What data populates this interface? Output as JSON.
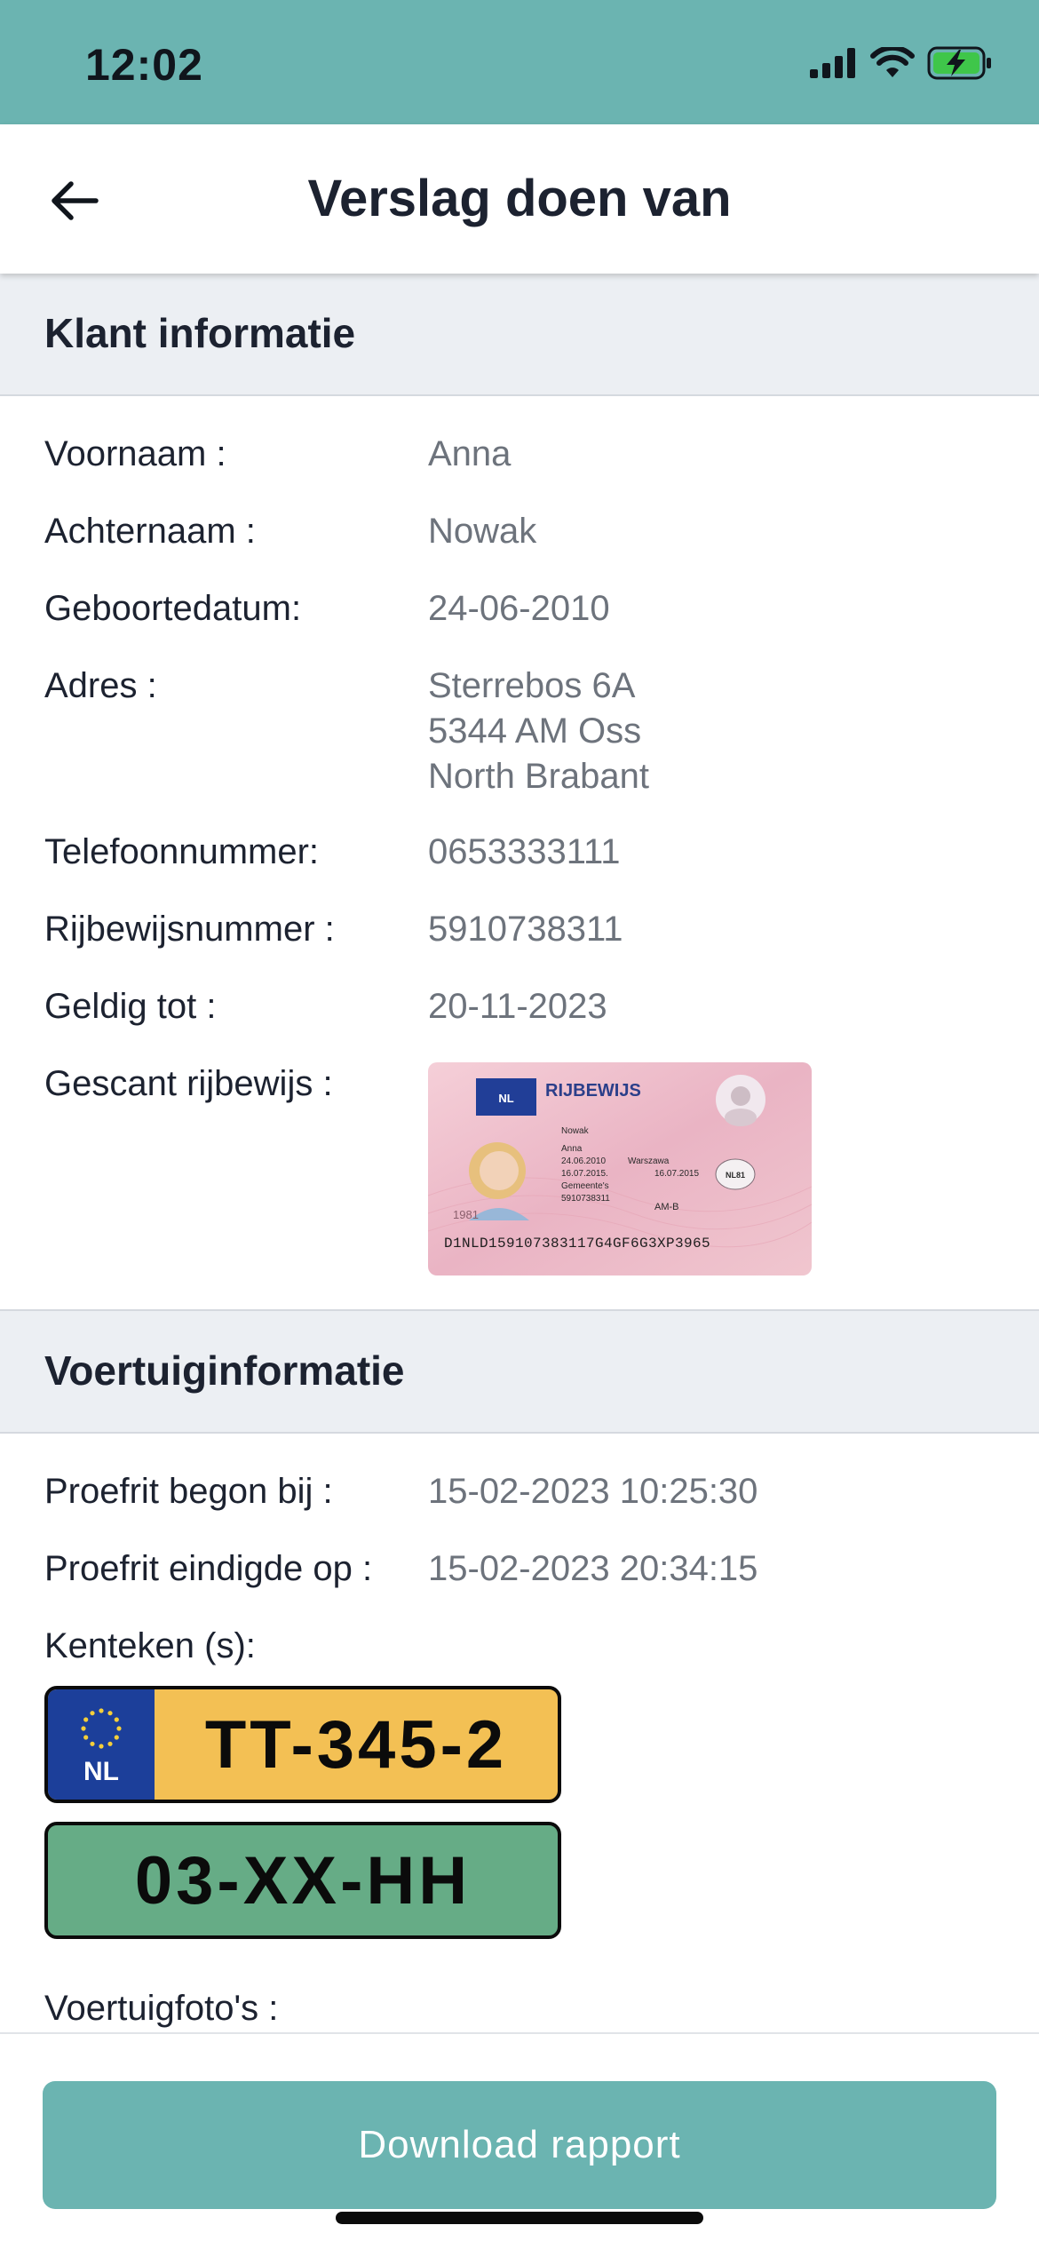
{
  "status_bar": {
    "time": "12:02"
  },
  "nav": {
    "title": "Verslag doen van"
  },
  "customer": {
    "section_title": "Klant informatie",
    "first_name_label": "Voornaam :",
    "first_name": "Anna",
    "last_name_label": "Achternaam :",
    "last_name": "Nowak",
    "dob_label": "Geboortedatum:",
    "dob": "24-06-2010",
    "address_label": "Adres :",
    "address": "Sterrebos 6A\n5344 AM Oss\nNorth Brabant",
    "phone_label": "Telefoonnummer:",
    "phone": "0653333111",
    "license_number_label": "Rijbewijsnummer :",
    "license_number": "5910738311",
    "valid_until_label": "Geldig tot :",
    "valid_until": "20-11-2023",
    "scanned_license_label": "Gescant rijbewijs :"
  },
  "license_card": {
    "country": "NL",
    "title": "RIJBEWIJS",
    "surname": "Nowak",
    "given_name": "Anna",
    "birth_date": "24.06.2010",
    "birth_place": "Warszawa",
    "issue_date": "16.07.2015.",
    "expiry_date": "16.07.2015",
    "authority": "Gemeente's",
    "number": "5910738311",
    "category": "AM-B",
    "badge": "NL81",
    "year": "1981",
    "mrz": "D1NLD159107383117G4GF6G3XP3965"
  },
  "vehicle": {
    "section_title": "Voertuiginformatie",
    "start_label": "Proefrit begon bij :",
    "start": "15-02-2023 10:25:30",
    "end_label": "Proefrit eindigde op :",
    "end": "15-02-2023 20:34:15",
    "plates_label": "Kenteken (s):",
    "plates": [
      {
        "text": "TT-345-2",
        "country": "NL"
      },
      {
        "text": "03-XX-HH"
      }
    ],
    "photos_label": "Voertuigfoto's :"
  },
  "colors": {
    "accent": "#6bb4b1",
    "plate_yellow": "#f3c054",
    "plate_green": "#66ac86",
    "eu_blue": "#1c3f9a"
  },
  "actions": {
    "download_label": "Download rapport"
  }
}
